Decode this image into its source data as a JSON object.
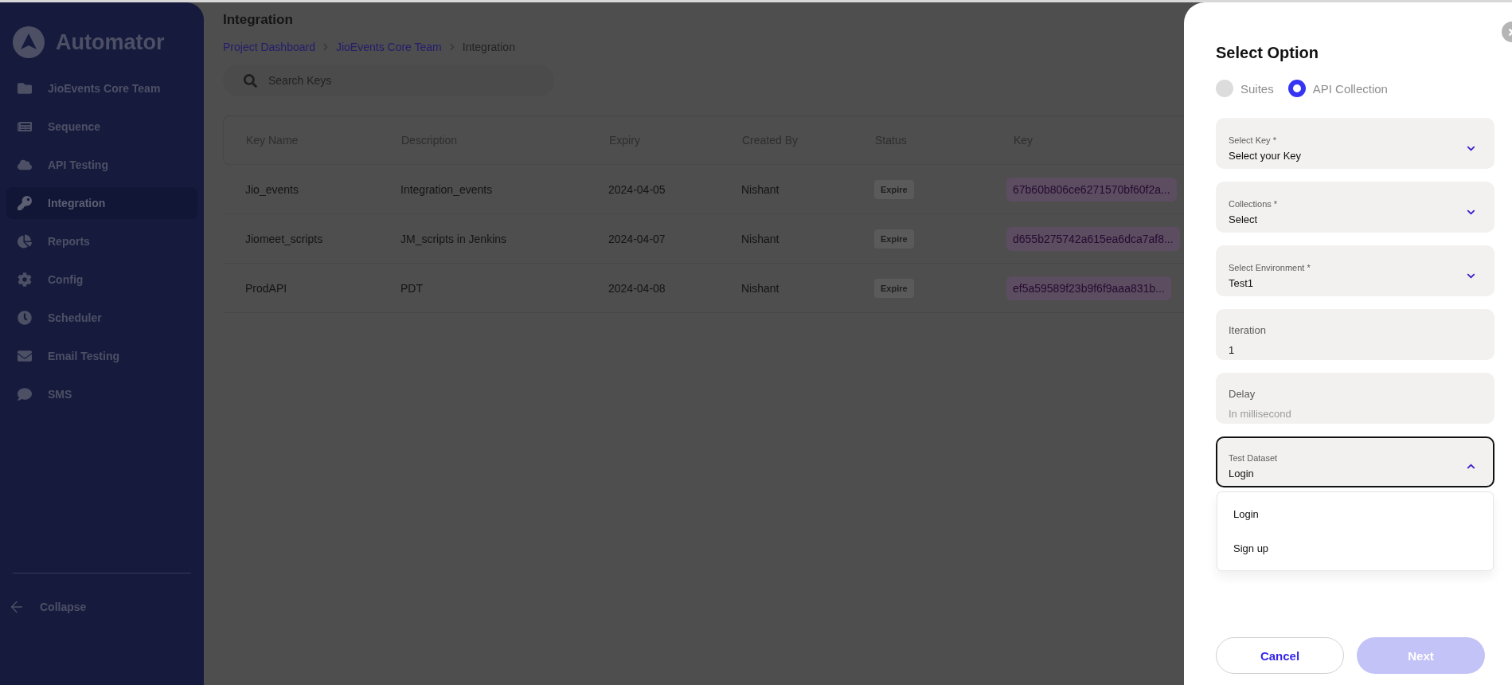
{
  "sidebar": {
    "brand": "Automator",
    "items": [
      {
        "label": "JioEvents Core Team",
        "selected": false
      },
      {
        "label": "Sequence",
        "selected": false
      },
      {
        "label": "API Testing",
        "selected": false
      },
      {
        "label": "Integration",
        "selected": true
      },
      {
        "label": "Reports",
        "selected": false
      },
      {
        "label": "Config",
        "selected": false
      },
      {
        "label": "Scheduler",
        "selected": false
      },
      {
        "label": "Email Testing",
        "selected": false
      },
      {
        "label": "SMS",
        "selected": false
      }
    ],
    "collapse": "Collapse"
  },
  "page": {
    "title": "Integration",
    "breadcrumb": [
      {
        "label": "Project Dashboard",
        "link": true
      },
      {
        "label": "JioEvents Core Team",
        "link": true
      },
      {
        "label": "Integration",
        "link": false
      }
    ],
    "search": {
      "placeholder": "Search Keys"
    }
  },
  "table": {
    "columns": [
      "Key Name",
      "Description",
      "Expiry",
      "Created By",
      "Status",
      "Key"
    ],
    "rows": [
      {
        "name": "Jio_events",
        "description": "Integration_events",
        "expiry": "2024-04-05",
        "created_by": "Nishant",
        "status": "Expire",
        "key": "67b60b806ce6271570bf60f2a..."
      },
      {
        "name": "Jiomeet_scripts",
        "description": "JM_scripts in Jenkins",
        "expiry": "2024-04-07",
        "created_by": "Nishant",
        "status": "Expire",
        "key": "d655b275742a615ea6dca7af8..."
      },
      {
        "name": "ProdAPI",
        "description": "PDT",
        "expiry": "2024-04-08",
        "created_by": "Nishant",
        "status": "Expire",
        "key": "ef5a59589f23b9f6f9aaa831b..."
      }
    ]
  },
  "drawer": {
    "title": "Select Option",
    "options": [
      {
        "label": "Suites",
        "selected": false
      },
      {
        "label": "API Collection",
        "selected": true
      }
    ],
    "fields": [
      {
        "kind": "select",
        "label": "Select Key *",
        "value": "Select your Key",
        "expanded": false
      },
      {
        "kind": "select",
        "label": "Collections *",
        "value": "Select",
        "expanded": false
      },
      {
        "kind": "select",
        "label": "Select Environment *",
        "value": "Test1",
        "expanded": false
      },
      {
        "kind": "input",
        "label": "Iteration",
        "value": "1"
      },
      {
        "kind": "input",
        "label": "Delay",
        "placeholder": "In millisecond"
      },
      {
        "kind": "select",
        "label": "Test Dataset",
        "value": "Login",
        "expanded": true,
        "menu": [
          "Login",
          "Sign up"
        ]
      }
    ],
    "buttons": [
      {
        "label": "Cancel",
        "disabled": false
      },
      {
        "label": "Next",
        "disabled": true
      }
    ]
  }
}
